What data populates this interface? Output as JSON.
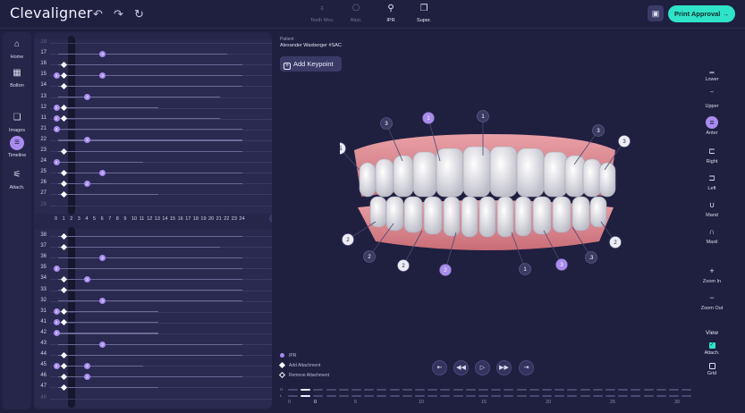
{
  "app": {
    "name": "Clevaligner"
  },
  "toolbar": {
    "undo_icon": "undo-icon",
    "redo_icon": "redo-icon",
    "reset_icon": "reset-icon",
    "tools": [
      {
        "label": "Teeth Mov.",
        "icon": "tooth-icon",
        "enabled": false
      },
      {
        "label": "Attat.",
        "icon": "attachment-icon",
        "enabled": false
      },
      {
        "label": "IPR",
        "icon": "ipr-icon",
        "enabled": true
      },
      {
        "label": "Super.",
        "icon": "superimpose-icon",
        "enabled": true
      }
    ],
    "save_icon": "save-icon",
    "print_label": "Print Approval",
    "print_arrow": "→"
  },
  "left_nav": [
    {
      "label": "Home",
      "icon": "home-icon",
      "glyph": "⌂"
    },
    {
      "label": "Bolton",
      "icon": "table-icon",
      "glyph": "▦"
    },
    {
      "label": "Images",
      "icon": "images-icon",
      "glyph": "❏"
    },
    {
      "label": "Timeline",
      "icon": "timeline-icon",
      "glyph": "≡",
      "active": true
    },
    {
      "label": "Attach.",
      "icon": "attach-icon",
      "glyph": "⚟"
    }
  ],
  "chart_data": {
    "type": "table",
    "upper_rows": [
      {
        "label": "18",
        "dim": true,
        "bar": null,
        "marks": []
      },
      {
        "label": "17",
        "bar": 22,
        "marks": [
          {
            "kind": "dot",
            "step": 6,
            "text": "3"
          }
        ]
      },
      {
        "label": "16",
        "bar": 24,
        "marks": [
          {
            "kind": "diamond",
            "step": 1
          }
        ]
      },
      {
        "label": "15",
        "bar": 24,
        "marks": [
          {
            "kind": "dot",
            "step": 0,
            "text": "3"
          },
          {
            "kind": "diamond",
            "step": 1
          },
          {
            "kind": "dot",
            "step": 6,
            "text": "3"
          }
        ]
      },
      {
        "label": "14",
        "bar": 24,
        "marks": [
          {
            "kind": "diamond",
            "step": 1
          }
        ]
      },
      {
        "label": "13",
        "bar": 21,
        "marks": [
          {
            "kind": "dot",
            "step": 4,
            "text": "3"
          }
        ]
      },
      {
        "label": "12",
        "bar": 13,
        "marks": [
          {
            "kind": "dot",
            "step": 0,
            "text": "2"
          },
          {
            "kind": "diamond",
            "step": 1
          }
        ]
      },
      {
        "label": "11",
        "bar": 21,
        "marks": [
          {
            "kind": "dot",
            "step": 0,
            "text": "2"
          },
          {
            "kind": "diamond",
            "step": 1
          }
        ]
      },
      {
        "label": "21",
        "bar": 24,
        "marks": [
          {
            "kind": "dot",
            "step": 0,
            "text": "3"
          }
        ]
      },
      {
        "label": "22",
        "bar": 24,
        "marks": [
          {
            "kind": "dot",
            "step": 4,
            "text": "3"
          }
        ]
      },
      {
        "label": "23",
        "bar": 24,
        "marks": [
          {
            "kind": "diamond",
            "step": 1
          }
        ]
      },
      {
        "label": "24",
        "bar": 11,
        "marks": [
          {
            "kind": "dot",
            "step": 0,
            "text": "2"
          }
        ]
      },
      {
        "label": "25",
        "bar": 24,
        "marks": [
          {
            "kind": "diamond",
            "step": 1
          },
          {
            "kind": "dot",
            "step": 6,
            "text": "2"
          }
        ]
      },
      {
        "label": "26",
        "bar": 24,
        "marks": [
          {
            "kind": "diamond",
            "step": 1
          },
          {
            "kind": "dot",
            "step": 4,
            "text": "2"
          }
        ]
      },
      {
        "label": "27",
        "bar": 13,
        "marks": [
          {
            "kind": "diamond",
            "step": 1
          }
        ]
      },
      {
        "label": "28",
        "dim": true,
        "bar": null,
        "marks": []
      }
    ],
    "axis_ticks": [
      "0",
      "1",
      "2",
      "3",
      "4",
      "5",
      "6",
      "7",
      "8",
      "9",
      "10",
      "11",
      "12",
      "13",
      "14",
      "15",
      "16",
      "17",
      "18",
      "19",
      "20",
      "21",
      "22",
      "23",
      "24"
    ],
    "lower_rows": [
      {
        "label": "38",
        "bar": 24,
        "marks": [
          {
            "kind": "diamond",
            "step": 1
          }
        ]
      },
      {
        "label": "37",
        "bar": 21,
        "marks": [
          {
            "kind": "diamond",
            "step": 1
          }
        ]
      },
      {
        "label": "36",
        "bar": 24,
        "marks": [
          {
            "kind": "dot",
            "step": 6,
            "text": "2"
          }
        ]
      },
      {
        "label": "35",
        "bar": 24,
        "marks": [
          {
            "kind": "dot",
            "step": 0,
            "text": "3"
          }
        ]
      },
      {
        "label": "34",
        "bar": 24,
        "marks": [
          {
            "kind": "diamond",
            "step": 1
          },
          {
            "kind": "dot",
            "step": 4,
            "text": "3"
          }
        ]
      },
      {
        "label": "33",
        "bar": 24,
        "marks": [
          {
            "kind": "diamond",
            "step": 1
          }
        ]
      },
      {
        "label": "32",
        "bar": 24,
        "marks": [
          {
            "kind": "dot",
            "step": 6,
            "text": "3"
          }
        ]
      },
      {
        "label": "31",
        "bar": 13,
        "marks": [
          {
            "kind": "dot",
            "step": 0,
            "text": "3"
          },
          {
            "kind": "diamond",
            "step": 1
          }
        ]
      },
      {
        "label": "41",
        "bar": 13,
        "marks": [
          {
            "kind": "dot",
            "step": 0,
            "text": "3"
          },
          {
            "kind": "diamond",
            "step": 1
          }
        ]
      },
      {
        "label": "42",
        "bar": 13,
        "marks": [
          {
            "kind": "dot",
            "step": 0,
            "text": "3"
          }
        ]
      },
      {
        "label": "43",
        "bar": 24,
        "marks": [
          {
            "kind": "dot",
            "step": 6,
            "text": "2"
          }
        ]
      },
      {
        "label": "44",
        "bar": 24,
        "marks": [
          {
            "kind": "diamond",
            "step": 1
          }
        ]
      },
      {
        "label": "45",
        "bar": 11,
        "marks": [
          {
            "kind": "dot",
            "step": 0,
            "text": "2"
          },
          {
            "kind": "diamond",
            "step": 1
          },
          {
            "kind": "dot",
            "step": 4,
            "text": "2"
          }
        ]
      },
      {
        "label": "46",
        "bar": 24,
        "marks": [
          {
            "kind": "diamond",
            "step": 1
          },
          {
            "kind": "dot",
            "step": 4,
            "text": "2"
          }
        ]
      },
      {
        "label": "47",
        "bar": 13,
        "marks": [
          {
            "kind": "diamond",
            "step": 1
          }
        ]
      },
      {
        "label": "48",
        "dim": true,
        "bar": null,
        "marks": []
      }
    ]
  },
  "patient": {
    "label": "Patient",
    "name": "Alexander Waxberger #SAC"
  },
  "add_keypoint": {
    "label": "Add Keypoint"
  },
  "ipr_markers": [
    "3",
    "1",
    "1",
    "3",
    "3",
    ".5",
    "2",
    "2",
    "2",
    "2",
    "1",
    "3",
    ".3",
    "2"
  ],
  "legend": [
    {
      "label": "IPR",
      "shape": "circle",
      "color": "#a98bf0"
    },
    {
      "label": "Add Attachment",
      "shape": "diamond",
      "color": "#ffffff"
    },
    {
      "label": "Remove Attachment",
      "shape": "diamond-outline",
      "color": "#ffffff"
    }
  ],
  "player": {
    "controls": [
      "first-step-icon",
      "prev-step-icon",
      "play-icon",
      "next-step-icon",
      "last-step-icon"
    ]
  },
  "timeline": {
    "rows": [
      "U",
      "L"
    ],
    "labels": [
      "0",
      "0",
      "5",
      "10",
      "15",
      "20",
      "25",
      "30"
    ],
    "current": "0"
  },
  "right_nav": [
    {
      "label": "Lower",
      "icon": "lower-icon",
      "glyph": "‗"
    },
    {
      "label": "Upper",
      "icon": "upper-icon",
      "glyph": "‾"
    },
    {
      "label": "Anter",
      "icon": "anterior-icon",
      "glyph": "≡",
      "active": true
    },
    {
      "label": "Right",
      "icon": "right-icon",
      "glyph": "⊏"
    },
    {
      "label": "Left",
      "icon": "left-icon",
      "glyph": "⊐"
    },
    {
      "label": "Mand",
      "icon": "mandible-icon",
      "glyph": "∪"
    },
    {
      "label": "Maxil",
      "icon": "maxilla-icon",
      "glyph": "∩"
    },
    {
      "label": "Zoom In",
      "icon": "zoom-in-icon",
      "glyph": "+"
    },
    {
      "label": "Zoom Out",
      "icon": "zoom-out-icon",
      "glyph": "−"
    }
  ],
  "view": {
    "title": "View",
    "options": [
      {
        "label": "Attach.",
        "checked": true
      },
      {
        "label": "Grid",
        "checked": false
      }
    ]
  },
  "colors": {
    "accent": "#a98bf0",
    "print": "#2fe3c9",
    "background": "#1f1f40",
    "panel": "#26264a"
  }
}
